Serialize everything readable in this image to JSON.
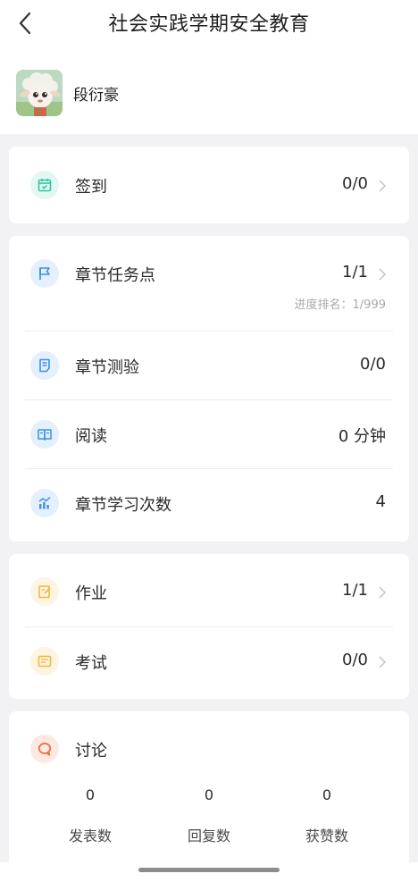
{
  "header": {
    "title": "社会实践学期安全教育"
  },
  "user": {
    "name": "段衍豪"
  },
  "card_checkin": {
    "label": "签到",
    "value": "0/0"
  },
  "card_chapter": {
    "task_label": "章节任务点",
    "task_value": "1/1",
    "task_sub": "进度排名：1/999",
    "quiz_label": "章节测验",
    "quiz_value": "0/0",
    "read_label": "阅读",
    "read_value": "0 分钟",
    "study_label": "章节学习次数",
    "study_value": "4"
  },
  "card_work": {
    "homework_label": "作业",
    "homework_value": "1/1",
    "exam_label": "考试",
    "exam_value": "0/0"
  },
  "card_discussion": {
    "label": "讨论",
    "stats": [
      {
        "num": "0",
        "label": "发表数"
      },
      {
        "num": "0",
        "label": "回复数"
      },
      {
        "num": "0",
        "label": "获赞数"
      }
    ]
  },
  "colors": {
    "checkin": "#2ec7a8",
    "chapter": "#3b8fe8",
    "work": "#f4b73e",
    "discussion": "#ef6a3a"
  },
  "icons": {
    "back": "chevron-left-icon",
    "checkin": "calendar-check-icon",
    "task": "flag-icon",
    "quiz": "document-icon",
    "read": "open-book-icon",
    "study": "chart-icon",
    "homework": "edit-note-icon",
    "exam": "exam-paper-icon",
    "discussion": "chat-bubble-icon"
  }
}
